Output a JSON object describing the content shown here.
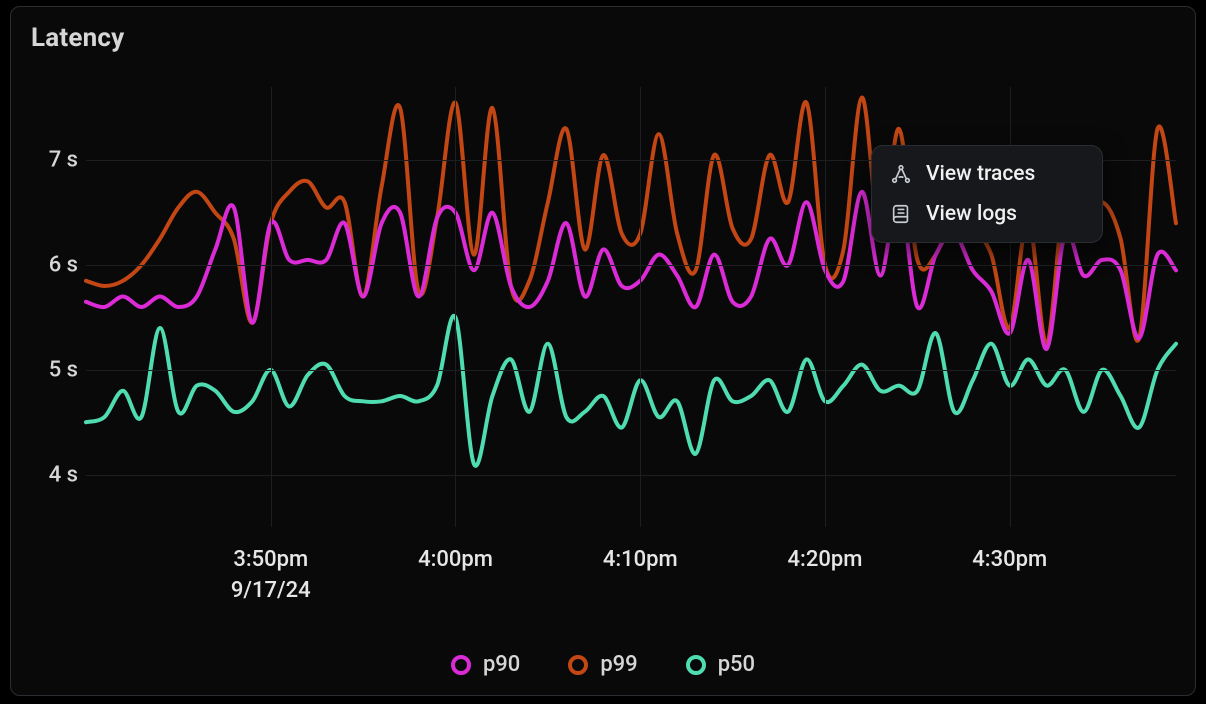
{
  "title": "Latency",
  "menu": {
    "traces": "View traces",
    "logs": "View logs"
  },
  "legend": {
    "p90": "p90",
    "p99": "p99",
    "p50": "p50"
  },
  "chart_data": {
    "type": "line",
    "title": "Latency",
    "xlabel": "",
    "ylabel": "",
    "ylim": [
      3.5,
      7.7
    ],
    "y_ticks": [
      4,
      5,
      6,
      7
    ],
    "y_tick_labels": [
      "4 s",
      "5 s",
      "6 s",
      "7 s"
    ],
    "x_tick_labels": [
      "3:50pm",
      "4:00pm",
      "4:10pm",
      "4:20pm",
      "4:30pm"
    ],
    "x_tick_date": "9/17/24",
    "x_tick_indices": [
      10,
      20,
      30,
      40,
      50
    ],
    "colors": {
      "p90": "#db2bd6",
      "p99": "#c24715",
      "p50": "#4fdcb1"
    },
    "series": [
      {
        "name": "p99",
        "values": [
          5.85,
          5.8,
          5.85,
          6.0,
          6.25,
          6.55,
          6.7,
          6.5,
          6.25,
          5.45,
          6.4,
          6.7,
          6.8,
          6.55,
          6.6,
          5.7,
          6.75,
          7.5,
          5.75,
          6.45,
          7.55,
          6.1,
          7.5,
          5.8,
          5.85,
          6.6,
          7.3,
          6.15,
          7.05,
          6.3,
          6.3,
          7.25,
          6.3,
          5.95,
          7.05,
          6.35,
          6.25,
          7.05,
          6.6,
          7.55,
          6.0,
          6.15,
          7.6,
          6.25,
          7.3,
          6.05,
          6.1,
          6.5,
          6.35,
          6.1,
          5.4,
          6.45,
          5.25,
          6.7,
          6.35,
          6.6,
          6.25,
          5.3,
          7.3,
          6.4
        ]
      },
      {
        "name": "p90",
        "values": [
          5.65,
          5.6,
          5.7,
          5.6,
          5.7,
          5.6,
          5.7,
          6.15,
          6.55,
          5.45,
          6.4,
          6.05,
          6.05,
          6.05,
          6.4,
          5.7,
          6.4,
          6.5,
          5.7,
          6.45,
          6.5,
          5.95,
          6.5,
          5.8,
          5.6,
          5.85,
          6.4,
          5.7,
          6.15,
          5.8,
          5.85,
          6.1,
          5.9,
          5.6,
          6.1,
          5.65,
          5.7,
          6.25,
          6.0,
          6.6,
          5.95,
          5.85,
          6.7,
          5.9,
          6.7,
          5.6,
          6.1,
          6.3,
          5.95,
          5.75,
          5.35,
          6.05,
          5.2,
          6.3,
          5.9,
          6.05,
          5.95,
          5.3,
          6.1,
          5.95
        ]
      },
      {
        "name": "p50",
        "values": [
          4.5,
          4.55,
          4.8,
          4.55,
          5.4,
          4.6,
          4.85,
          4.8,
          4.6,
          4.7,
          5.0,
          4.65,
          4.95,
          5.05,
          4.75,
          4.7,
          4.7,
          4.75,
          4.7,
          4.85,
          5.5,
          4.1,
          4.75,
          5.1,
          4.6,
          5.25,
          4.55,
          4.6,
          4.75,
          4.45,
          4.9,
          4.55,
          4.7,
          4.2,
          4.9,
          4.7,
          4.75,
          4.9,
          4.6,
          5.1,
          4.7,
          4.85,
          5.05,
          4.8,
          4.85,
          4.8,
          5.35,
          4.6,
          4.9,
          5.25,
          4.85,
          5.1,
          4.85,
          5.0,
          4.6,
          5.0,
          4.75,
          4.45,
          5.0,
          5.25
        ]
      }
    ]
  }
}
